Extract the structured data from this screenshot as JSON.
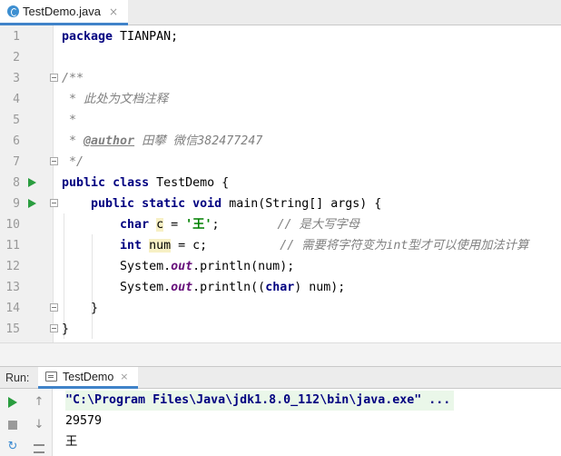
{
  "tab": {
    "label": "TestDemo.java",
    "close": "×"
  },
  "editor": {
    "line_numbers": [
      "1",
      "2",
      "3",
      "4",
      "5",
      "6",
      "7",
      "8",
      "9",
      "10",
      "11",
      "12",
      "13",
      "14",
      "15"
    ],
    "l1": {
      "kw": "package",
      "rest": " TIANPAN;"
    },
    "l3": "/**",
    "l4": " * 此处为文档注释",
    "l5": " *",
    "l6": {
      "pre": " * ",
      "tag": "@author",
      "post": " 田攀 微信382477247"
    },
    "l7": " */",
    "l8": {
      "kw1": "public",
      "sp1": " ",
      "kw2": "class",
      "rest": " TestDemo {"
    },
    "l9": {
      "kw1": "public",
      "kw2": "static",
      "kw3": "void",
      "rest": " main(String[] args) {"
    },
    "l10": {
      "kw": "char",
      "var": "c",
      "eq": " = ",
      "str": "'王'",
      "semi": ";",
      "comment": "// 是大写字母"
    },
    "l11": {
      "kw": "int",
      "var": "num",
      "rest": " = c;",
      "comment": "// 需要将字符变为int型才可以使用加法计算"
    },
    "l12": {
      "pre": "System.",
      "field": "out",
      "post": ".println(num);"
    },
    "l13": {
      "pre": "System.",
      "field": "out",
      "post": ".println((",
      "kw": "char",
      "end": ") num);"
    },
    "l14": "}",
    "l15": "}"
  },
  "run": {
    "title": "Run:",
    "tab_label": "TestDemo",
    "tab_close": "×",
    "command": "\"C:\\Program Files\\Java\\jdk1.8.0_112\\bin\\java.exe\" ...",
    "output": [
      "29579",
      "王"
    ]
  },
  "icons": {
    "run": "run-icon",
    "stop": "stop-icon",
    "up": "up-arrow-icon",
    "down": "down-arrow-icon",
    "wrap": "soft-wrap-icon",
    "rerun": "rerun-icon"
  },
  "colors": {
    "keyword": "#000080",
    "comment": "#808080",
    "string": "#008000",
    "static_field": "#660e7a",
    "run_green": "#2a9d3f",
    "accent": "#4083c9"
  }
}
